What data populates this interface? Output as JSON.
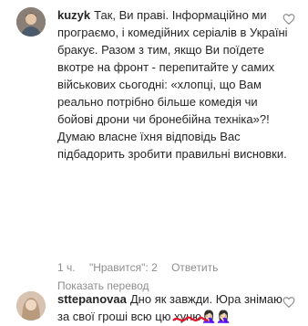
{
  "comments": [
    {
      "username": "kuzyk",
      "text": "Так, Ви праві. Інформаційно ми програємо, і комедійних серіалів в Україні бракує. Разом з тим, якщо Ви поїдете вкотре на фронт - перепитайте у самих військових сьогодні: «хлопці, що Вам реально потрібно більше комедія чи бойові дрони чи бронебійна техніка»?! Думаю власне їхня відповідь Вас підбадорить зробити правильні висновки.",
      "time": "1 ч.",
      "likes": "\"Нравится\": 2",
      "reply": "Ответить",
      "translate": "Показать перевод"
    },
    {
      "username": "sttepanovaa",
      "text_before": "Дно як завжди. Юра знімаю за свої гроші всю цю ",
      "text_marked": "ху",
      "text_after": "ню🤦🏻‍♀️🤦🏻‍♀️"
    }
  ],
  "icons": {
    "like": "heart-outline-icon"
  },
  "colors": {
    "scribble": "#e0162b",
    "meta": "#8e8e8e"
  }
}
